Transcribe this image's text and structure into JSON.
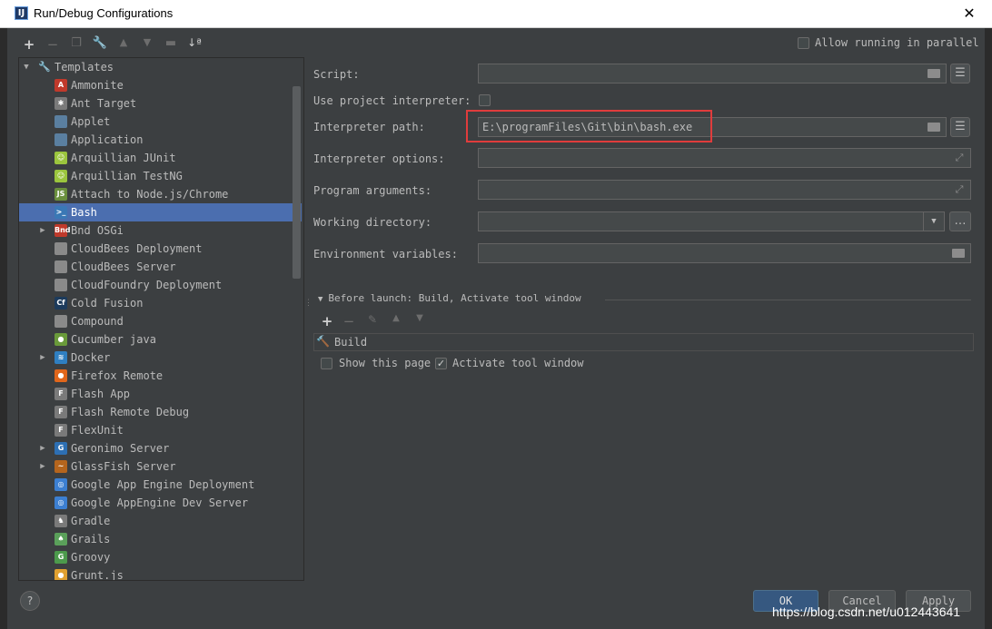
{
  "window": {
    "title": "Run/Debug Configurations",
    "icon_text": "IJ",
    "accent": "#4b6eaf",
    "highlight_color": "#e03c3c"
  },
  "toolbar": {
    "icons": [
      "add-icon",
      "remove-icon",
      "copy-icon",
      "wrench-icon",
      "move-up-icon",
      "move-down-icon",
      "folder-icon",
      "sort-icon"
    ]
  },
  "allow_parallel": {
    "label": "Allow running in parallel",
    "checked": false
  },
  "tree": {
    "root": {
      "label": "Templates",
      "expanded": true
    },
    "items": [
      {
        "label": "Ammonite",
        "expandable": false,
        "icon": "ammonite-icon",
        "color": "#c0392b",
        "glyph": "A"
      },
      {
        "label": "Ant Target",
        "expandable": false,
        "icon": "ant-icon",
        "color": "#7a7a7a",
        "glyph": "✱"
      },
      {
        "label": "Applet",
        "expandable": false,
        "icon": "applet-icon",
        "color": "#5a7fa0",
        "glyph": ""
      },
      {
        "label": "Application",
        "expandable": false,
        "icon": "application-icon",
        "color": "#5a7fa0",
        "glyph": ""
      },
      {
        "label": "Arquillian JUnit",
        "expandable": false,
        "icon": "arquillian-icon",
        "color": "#9bc53d",
        "glyph": "☺"
      },
      {
        "label": "Arquillian TestNG",
        "expandable": false,
        "icon": "arquillian-icon",
        "color": "#9bc53d",
        "glyph": "☺"
      },
      {
        "label": "Attach to Node.js/Chrome",
        "expandable": false,
        "icon": "nodejs-icon",
        "color": "#6a8f3d",
        "glyph": "JS"
      },
      {
        "label": "Bash",
        "expandable": false,
        "icon": "bash-icon",
        "color": "#3a78b5",
        "glyph": ">_",
        "selected": true
      },
      {
        "label": "Bnd OSGi",
        "expandable": true,
        "icon": "bnd-icon",
        "color": "#c0392b",
        "glyph": "Bnd"
      },
      {
        "label": "CloudBees Deployment",
        "expandable": false,
        "icon": "cloud-icon",
        "color": "#8a8a8a",
        "glyph": ""
      },
      {
        "label": "CloudBees Server",
        "expandable": false,
        "icon": "cloud-icon",
        "color": "#8a8a8a",
        "glyph": ""
      },
      {
        "label": "CloudFoundry Deployment",
        "expandable": false,
        "icon": "cloud-icon",
        "color": "#8a8a8a",
        "glyph": ""
      },
      {
        "label": "Cold Fusion",
        "expandable": false,
        "icon": "coldfusion-icon",
        "color": "#1d3b5c",
        "glyph": "Cf"
      },
      {
        "label": "Compound",
        "expandable": false,
        "icon": "folder-icon",
        "color": "#8a8a8a",
        "glyph": ""
      },
      {
        "label": "Cucumber java",
        "expandable": false,
        "icon": "cucumber-icon",
        "color": "#6a9a3a",
        "glyph": "●"
      },
      {
        "label": "Docker",
        "expandable": true,
        "icon": "docker-icon",
        "color": "#2f7fc1",
        "glyph": "≋"
      },
      {
        "label": "Firefox Remote",
        "expandable": false,
        "icon": "firefox-icon",
        "color": "#e0661b",
        "glyph": "●"
      },
      {
        "label": "Flash App",
        "expandable": false,
        "icon": "flash-icon",
        "color": "#7a7a7a",
        "glyph": "F"
      },
      {
        "label": "Flash Remote Debug",
        "expandable": false,
        "icon": "flash-icon",
        "color": "#7a7a7a",
        "glyph": "F"
      },
      {
        "label": "FlexUnit",
        "expandable": false,
        "icon": "flexunit-icon",
        "color": "#7a7a7a",
        "glyph": "F"
      },
      {
        "label": "Geronimo Server",
        "expandable": true,
        "icon": "geronimo-icon",
        "color": "#2d6fb3",
        "glyph": "G"
      },
      {
        "label": "GlassFish Server",
        "expandable": true,
        "icon": "glassfish-icon",
        "color": "#b5651d",
        "glyph": "~"
      },
      {
        "label": "Google App Engine Deployment",
        "expandable": false,
        "icon": "appengine-icon",
        "color": "#3c7fd1",
        "glyph": "◎"
      },
      {
        "label": "Google AppEngine Dev Server",
        "expandable": false,
        "icon": "appengine-icon",
        "color": "#3c7fd1",
        "glyph": "◎"
      },
      {
        "label": "Gradle",
        "expandable": false,
        "icon": "gradle-icon",
        "color": "#7a7a7a",
        "glyph": "♞"
      },
      {
        "label": "Grails",
        "expandable": false,
        "icon": "grails-icon",
        "color": "#5aa05a",
        "glyph": "♠"
      },
      {
        "label": "Groovy",
        "expandable": false,
        "icon": "groovy-icon",
        "color": "#4c9a4c",
        "glyph": "G"
      },
      {
        "label": "Grunt.js",
        "expandable": false,
        "icon": "grunt-icon",
        "color": "#e0a030",
        "glyph": "●"
      }
    ]
  },
  "form": {
    "script": {
      "label": "Script:",
      "value": ""
    },
    "use_project_interpreter": {
      "label": "Use project interpreter:",
      "checked": false
    },
    "interpreter_path": {
      "label": "Interpreter path:",
      "value": "E:\\programFiles\\Git\\bin\\bash.exe"
    },
    "interpreter_options": {
      "label": "Interpreter options:",
      "value": ""
    },
    "program_arguments": {
      "label": "Program arguments:",
      "value": ""
    },
    "working_directory": {
      "label": "Working directory:",
      "value": ""
    },
    "environment_variables": {
      "label": "Environment variables:",
      "value": ""
    }
  },
  "before_launch": {
    "header": "Before launch: Build, Activate tool window",
    "items": [
      "Build"
    ],
    "show_this_page": {
      "label": "Show this page",
      "checked": false
    },
    "activate_tool_window": {
      "label": "Activate tool window",
      "checked": true
    }
  },
  "buttons": {
    "ok": "OK",
    "cancel": "Cancel",
    "apply": "Apply",
    "help": "?"
  },
  "watermark": "https://blog.csdn.net/u012443641"
}
